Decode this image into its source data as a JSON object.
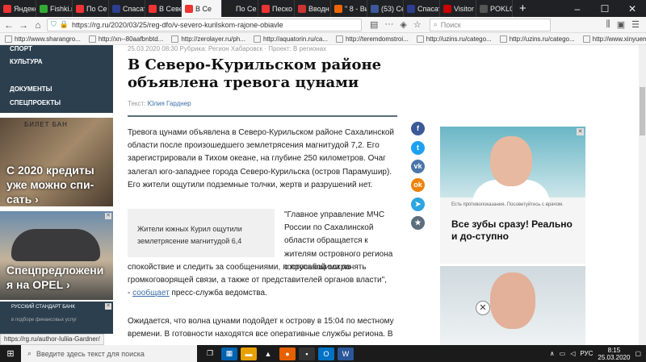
{
  "browser": {
    "tabs": [
      {
        "label": "Яндекс",
        "color": "#e33"
      },
      {
        "label": "Fishki.r",
        "color": "#3a3"
      },
      {
        "label": "По Се",
        "color": "#e33"
      },
      {
        "label": "Спасат",
        "color": "#2c3e8f"
      },
      {
        "label": "В Севе",
        "color": "#e33"
      },
      {
        "label": "В Се",
        "color": "#e33",
        "active": true
      },
      {
        "label": "По Се",
        "color": "#222"
      },
      {
        "label": "Песко",
        "color": "#e33"
      },
      {
        "label": "Вводн",
        "color": "#c33"
      },
      {
        "label": "\" 8 - Ви",
        "color": "#e60"
      },
      {
        "label": "(53) Се",
        "color": "#3b5998"
      },
      {
        "label": "Спасат",
        "color": "#2c3e8f"
      },
      {
        "label": "Visitor",
        "color": "#c00"
      },
      {
        "label": "POKLONK",
        "color": "#555"
      }
    ],
    "url": "https://rg.ru/2020/03/25/reg-dfo/v-severo-kurilskom-rajone-obiavle",
    "search_placeholder": "Поиск",
    "bookmarks": [
      "http://www.sharangro...",
      "http://xn--80aafbnbtd...",
      "http://zerolayer.ru/ph...",
      "http://aquatorin.ru/ca...",
      "http://teremdomstroi...",
      "http://uzins.ru/catego...",
      "http://uzins.ru/catego...",
      "http://www.xinyuemu..."
    ]
  },
  "left_nav": {
    "items": [
      "СПОРТ",
      "КУЛЬТУРА",
      "ДОКУМЕНТЫ",
      "СПЕЦПРОЕКТЫ"
    ]
  },
  "left_ads": {
    "ad1_text": "С 2020 кредиты уже можно спи-сать ›",
    "ad1_money": "БИЛЕТ БАН",
    "ad2_text": "Спецпредложени я на OPEL ›",
    "ad3_bank": "РУССКИЙ СТАНДАРТ БАНК",
    "ad3_small": "в подборе финансовых услуг"
  },
  "article": {
    "meta": "25.03.2020 08:30 Рубрика: Регион Хабаровск · Проект: В регионах",
    "title": "В Северо-Курильском районе объявлена тревога цунами",
    "byline_label": "Текст:",
    "author": "Юлия Гарднер",
    "paragraph1": "Тревога цунами объявлена в Северо-Курильском районе Сахалинской области после произошедшего землетрясения магнитудой 7,2. Его зарегистрировали в Тихом океане, на глубине 250 километров. Очаг залегал юго-западнее города Северо-Курильска (остров Парамушир). Его жители ощутили подземные толчки, жертв и разрушений нет.",
    "quote_box": "Жители южных Курил ощутили землетрясение магнитудой 6,4",
    "quote_part1": "\"Главное управление МЧС России по Сахалинской области обращается к жителям островного региона с просьбой сохранять",
    "quote_part2": "спокойствие и следить за сообщениями, поступающими по громкоговорящей связи, а также от представителей органов власти\",",
    "quote_dash": "- ",
    "quote_link": "сообщает",
    "quote_tail": " пресс-служба ведомства.",
    "paragraph3": "Ожидается, что волна цунами подойдет к острову в 15:04 по местному времени. В готовности находятся все оперативные службы региона. В"
  },
  "share": [
    {
      "icon": "facebook-icon",
      "glyph": "f",
      "color": "#3b5998"
    },
    {
      "icon": "twitter-icon",
      "glyph": "t",
      "color": "#1da1f2"
    },
    {
      "icon": "vk-icon",
      "glyph": "vk",
      "color": "#4a76a8"
    },
    {
      "icon": "ok-icon",
      "glyph": "ok",
      "color": "#ee8208"
    },
    {
      "icon": "telegram-icon",
      "glyph": "➤",
      "color": "#2ca5e0"
    },
    {
      "icon": "bookmark-star-icon",
      "glyph": "★",
      "color": "#5b6e7c"
    }
  ],
  "right_ad": {
    "disclaimer": "Есть противопоказания. Посоветуйтесь с врачом.",
    "headline": "Все зубы сразу! Реально и до-ступно"
  },
  "status_link": "https://rg.ru/author-Iuliia-Gardner/",
  "taskbar": {
    "search_placeholder": "Введите здесь текст для поиска",
    "lang": "РУС",
    "time": "8:15",
    "date": "25.03.2020"
  }
}
